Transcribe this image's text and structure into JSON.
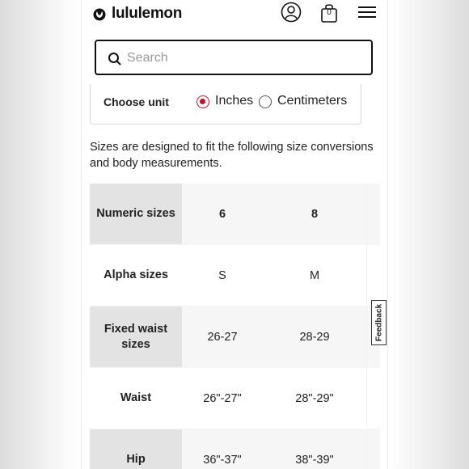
{
  "header": {
    "brand": "lululemon",
    "bag_count": "0",
    "icons": [
      "lululemon-logo-icon",
      "user-account-icon",
      "shopping-bag-icon",
      "hamburger-menu-icon"
    ]
  },
  "search": {
    "placeholder": "Search"
  },
  "unit_selector": {
    "label": "Choose unit",
    "options": [
      "Inches",
      "Centimeters"
    ],
    "selected": "Inches"
  },
  "intro_text": "Sizes are designed to fit the following size conversions and body measurements.",
  "size_table": {
    "rows": [
      {
        "header": "Numeric sizes",
        "values": [
          "6",
          "8"
        ]
      },
      {
        "header": "Alpha sizes",
        "values": [
          "S",
          "M"
        ]
      },
      {
        "header": "Fixed waist sizes",
        "values": [
          "26-27",
          "28-29"
        ]
      },
      {
        "header": "Waist",
        "values": [
          "26\"-27\"",
          "28\"-29\""
        ]
      },
      {
        "header": "Hip",
        "values": [
          "36\"-37\"",
          "38\"-39\""
        ]
      }
    ]
  },
  "feedback": {
    "label": "Feedback"
  },
  "colors": {
    "accent": "#c8102e",
    "header_cell": "#e3e3e3"
  }
}
